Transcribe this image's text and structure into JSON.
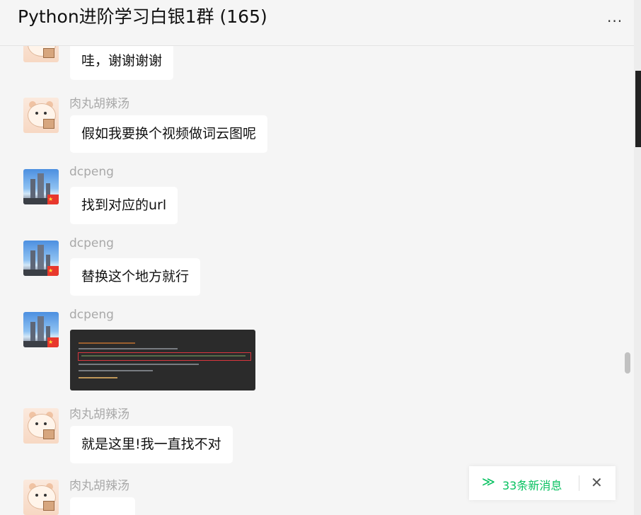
{
  "header": {
    "title": "Python进阶学习白银1群 (165)",
    "more_icon": "more-horizontal-icon",
    "more_label": "···"
  },
  "messages": [
    {
      "sender": "",
      "avatar": "hamster",
      "type": "text",
      "text": "哇，谢谢谢谢"
    },
    {
      "sender": "肉丸胡辣汤",
      "avatar": "hamster",
      "type": "text",
      "text": "假如我要换个视频做词云图呢"
    },
    {
      "sender": "dcpeng",
      "avatar": "city",
      "type": "text",
      "text": "找到对应的url"
    },
    {
      "sender": "dcpeng",
      "avatar": "city",
      "type": "text",
      "text": "替换这个地方就行"
    },
    {
      "sender": "dcpeng",
      "avatar": "city",
      "type": "image",
      "text": ""
    },
    {
      "sender": "肉丸胡辣汤",
      "avatar": "hamster",
      "type": "text",
      "text": "就是这里!我一直找不对"
    },
    {
      "sender": "肉丸胡辣汤",
      "avatar": "hamster",
      "type": "text",
      "text": ""
    }
  ],
  "new_messages": {
    "label": "33条新消息",
    "icon": "double-chevron-down-icon",
    "close_icon": "close-icon",
    "chevron_glyph": "≫",
    "close_glyph": "✕"
  },
  "colors": {
    "accent": "#07c160",
    "background": "#f5f5f5",
    "bubble": "#ffffff",
    "name": "#a9a9a9"
  }
}
